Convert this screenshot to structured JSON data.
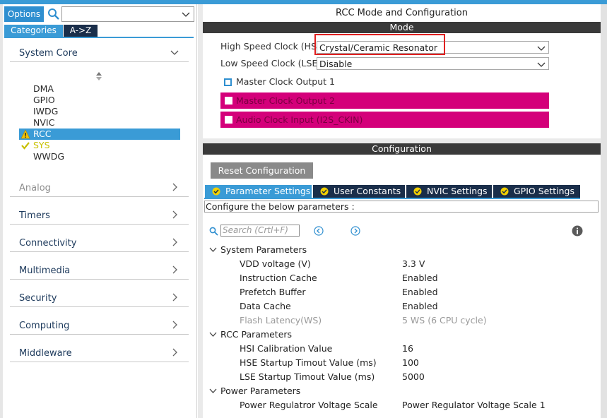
{
  "left": {
    "options_label": "Options",
    "search_value": "",
    "tabs": [
      "Categories",
      "A->Z"
    ],
    "sections": {
      "system_core": "System Core",
      "analog": "Analog",
      "timers": "Timers",
      "connectivity": "Connectivity",
      "multimedia": "Multimedia",
      "security": "Security",
      "computing": "Computing",
      "middleware": "Middleware"
    },
    "items": [
      "DMA",
      "GPIO",
      "IWDG",
      "NVIC",
      "RCC",
      "SYS",
      "WWDG"
    ]
  },
  "right": {
    "title": "RCC Mode and Configuration",
    "mode_bar": "Mode",
    "hse_label": "High Speed Clock (HSE)",
    "hse_value": "Crystal/Ceramic Resonator",
    "lse_label": "Low Speed Clock (LSE)",
    "lse_value": "Disable",
    "mco1": "Master Clock Output 1",
    "mco2": "Master Clock Output 2",
    "i2s": "Audio Clock Input (I2S_CKIN)",
    "config_bar": "Configuration",
    "reset_label": "Reset Configuration",
    "tabs": [
      "Parameter Settings",
      "User Constants",
      "NVIC Settings",
      "GPIO Settings"
    ],
    "description": "Configure the below parameters :",
    "search_placeholder": "Search (Crtl+F)",
    "groups": {
      "system": "System Parameters",
      "rcc": "RCC Parameters",
      "power": "Power Parameters"
    },
    "params": [
      {
        "name": "VDD voltage (V)",
        "value": "3.3 V"
      },
      {
        "name": "Instruction Cache",
        "value": "Enabled"
      },
      {
        "name": "Prefetch Buffer",
        "value": "Enabled"
      },
      {
        "name": "Data Cache",
        "value": "Enabled"
      },
      {
        "name": "Flash Latency(WS)",
        "value": "5 WS (6 CPU cycle)"
      },
      {
        "name": "HSI Calibration Value",
        "value": "16"
      },
      {
        "name": "HSE Startup Timout Value (ms)",
        "value": "100"
      },
      {
        "name": "LSE Startup Timout Value (ms)",
        "value": "5000"
      },
      {
        "name": "Power Regulatror Voltage Scale",
        "value": "Power Regulator Voltage Scale 1"
      }
    ]
  },
  "colors": {
    "accent": "#3a9bd6",
    "dark_bar": "#3a3a3a",
    "tab_dark": "#1a2e4a",
    "pink": "#d4007a",
    "highlight": "#e02020"
  }
}
